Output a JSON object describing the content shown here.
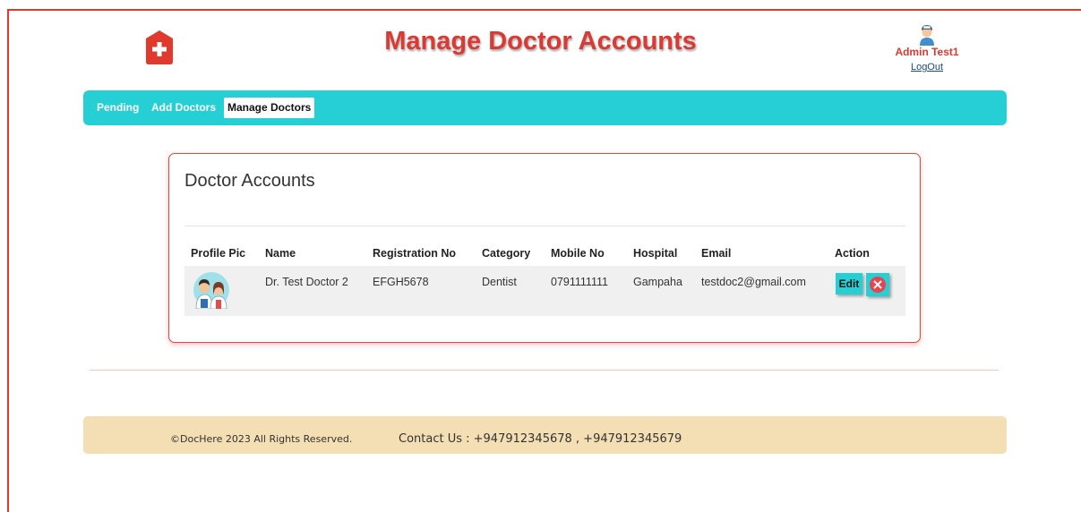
{
  "header": {
    "title": "Manage Doctor Accounts",
    "logo_icon": "hospital-plus-icon",
    "user": {
      "name": "Admin Test1",
      "logout_label": "LogOut",
      "avatar_icon": "nurse-avatar-icon"
    }
  },
  "nav": {
    "items": [
      {
        "label": "Pending",
        "active": false
      },
      {
        "label": "Add Doctors",
        "active": false
      },
      {
        "label": "Manage Doctors",
        "active": true
      }
    ]
  },
  "card": {
    "title": "Doctor Accounts",
    "columns": [
      "Profile Pic",
      "Name",
      "Registration No",
      "Category",
      "Mobile No",
      "Hospital",
      "Email",
      "Action"
    ],
    "rows": [
      {
        "profile_icon": "doctor-avatar-icon",
        "name": "Dr. Test Doctor 2",
        "registration_no": "EFGH5678",
        "category": "Dentist",
        "mobile": "0791111111",
        "hospital": "Gampaha",
        "email": "testdoc2@gmail.com",
        "edit_label": "Edit"
      }
    ]
  },
  "footer": {
    "copyright": "©DocHere 2023 All Rights Reserved.",
    "contact": "Contact Us : +947912345678 , +947912345679"
  },
  "colors": {
    "accent": "#26cfd4",
    "brand_red": "#d93a33",
    "footer_bg": "#f4deb3",
    "delete": "#e8434f"
  }
}
